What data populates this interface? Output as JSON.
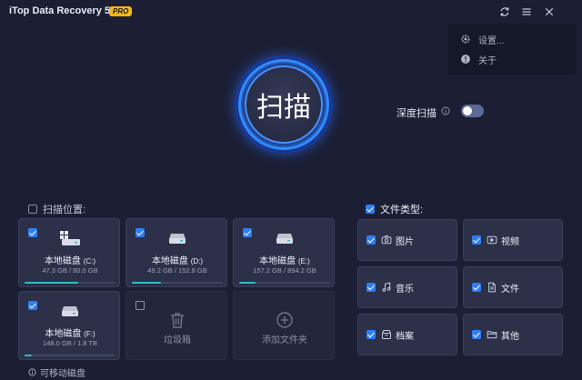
{
  "app": {
    "title": "iTop Data Recovery 5.4",
    "badge": "PRO"
  },
  "titlebar_icons": [
    "refresh-icon",
    "menu-icon",
    "close-icon"
  ],
  "menu": {
    "items": [
      {
        "label": "设置...",
        "icon": "gear-icon"
      },
      {
        "label": "关于",
        "icon": "info-circle-icon"
      }
    ]
  },
  "scan": {
    "button_label": "扫描",
    "deep_scan_label": "深度扫描",
    "deep_scan_enabled": false
  },
  "locations": {
    "header": "扫描位置:",
    "checked": false,
    "drives": [
      {
        "name": "本地磁盘",
        "letter": "(C:)",
        "size": "47.3 GB / 80.0 GB",
        "used_fraction": 0.59,
        "checked": true,
        "icon": "windows-drive-icon"
      },
      {
        "name": "本地磁盘",
        "letter": "(D:)",
        "size": "49.2 GB / 152.8 GB",
        "used_fraction": 0.32,
        "checked": true,
        "icon": "hard-drive-icon"
      },
      {
        "name": "本地磁盘",
        "letter": "(E:)",
        "size": "157.2 GB / 894.2 GB",
        "used_fraction": 0.18,
        "checked": true,
        "icon": "hard-drive-icon"
      },
      {
        "name": "本地磁盘",
        "letter": "(F:)",
        "size": "148.0 GB / 1.8 TB",
        "used_fraction": 0.08,
        "checked": true,
        "icon": "hard-drive-icon"
      }
    ],
    "recycle_bin": {
      "label": "垃圾箱",
      "checked": false
    },
    "add_folder": {
      "label": "添加文件夹"
    },
    "removable_label": "可移动磁盘"
  },
  "file_types": {
    "header": "文件类型:",
    "checked": true,
    "items": [
      {
        "label": "图片",
        "icon": "camera-icon",
        "checked": true
      },
      {
        "label": "视频",
        "icon": "video-icon",
        "checked": true
      },
      {
        "label": "音乐",
        "icon": "music-note-icon",
        "checked": true
      },
      {
        "label": "文件",
        "icon": "document-icon",
        "checked": true
      },
      {
        "label": "档案",
        "icon": "archive-icon",
        "checked": true
      },
      {
        "label": "其他",
        "icon": "folder-icon",
        "checked": true
      }
    ]
  },
  "colors": {
    "background": "#1c1f34",
    "accent_blue": "#2f7ef7",
    "progress_teal": "#2bc0c4",
    "badge_yellow": "#f3b81c"
  }
}
